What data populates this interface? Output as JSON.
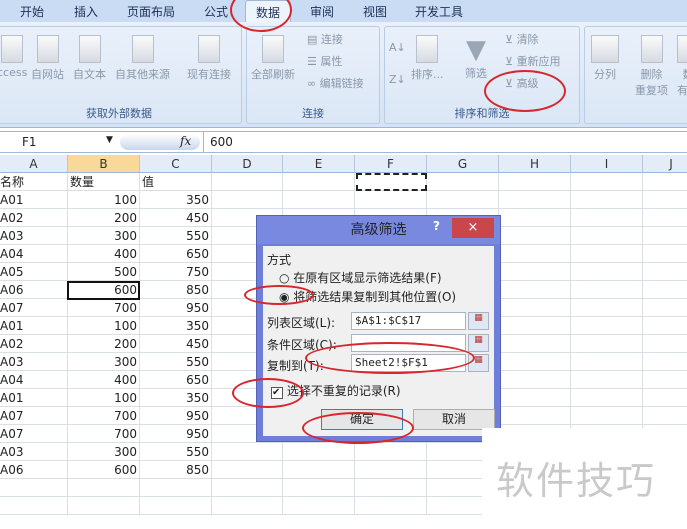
{
  "tabs": [
    "开始",
    "插入",
    "页面布局",
    "公式",
    "数据",
    "审阅",
    "视图",
    "开发工具"
  ],
  "ribbon": {
    "get_external": {
      "label": "获取外部数据",
      "buttons": [
        "ccess",
        "自网站",
        "自文本",
        "自其他来源",
        "现有连接"
      ]
    },
    "connections": {
      "label": "连接",
      "refresh_all": "全部刷新",
      "items": [
        "连接",
        "属性",
        "编辑链接"
      ]
    },
    "sort_filter": {
      "label": "排序和筛选",
      "sort": "排序...",
      "filter": "筛选",
      "items": [
        "清除",
        "重新应用",
        "高级"
      ]
    },
    "data_tools": {
      "split": "分列",
      "remove_dup_1": "删除",
      "remove_dup_2": "重复项",
      "more1": "数",
      "more2": "有效"
    }
  },
  "formula_bar": {
    "name_box": "F1",
    "fx": "fx",
    "value": "600"
  },
  "columns": [
    "A",
    "B",
    "C",
    "D",
    "E",
    "F",
    "G",
    "H",
    "I",
    "J"
  ],
  "rows": [
    [
      "名称",
      "数量",
      "值"
    ],
    [
      "A01",
      "100",
      "350"
    ],
    [
      "A02",
      "200",
      "450"
    ],
    [
      "A03",
      "300",
      "550"
    ],
    [
      "A04",
      "400",
      "650"
    ],
    [
      "A05",
      "500",
      "750"
    ],
    [
      "A06",
      "600",
      "850"
    ],
    [
      "A07",
      "700",
      "950"
    ],
    [
      "A01",
      "100",
      "350"
    ],
    [
      "A02",
      "200",
      "450"
    ],
    [
      "A03",
      "300",
      "550"
    ],
    [
      "A04",
      "400",
      "650"
    ],
    [
      "A01",
      "100",
      "350"
    ],
    [
      "A07",
      "700",
      "950"
    ],
    [
      "A07",
      "700",
      "950"
    ],
    [
      "A03",
      "300",
      "550"
    ],
    [
      "A06",
      "600",
      "850"
    ]
  ],
  "dialog": {
    "title": "高级筛选",
    "help": "?",
    "close": "×",
    "section": "方式",
    "radio1": "在原有区域显示筛选结果(F)",
    "radio2": "将筛选结果复制到其他位置(O)",
    "list_label": "列表区域(L):",
    "list_value": "$A$1:$C$17",
    "criteria_label": "条件区域(C):",
    "criteria_value": "",
    "copy_label": "复制到(T):",
    "copy_value": "Sheet2!$F$1",
    "unique_label": "选择不重复的记录(R)",
    "ok": "确定",
    "cancel": "取消"
  },
  "watermark": "软件技巧"
}
